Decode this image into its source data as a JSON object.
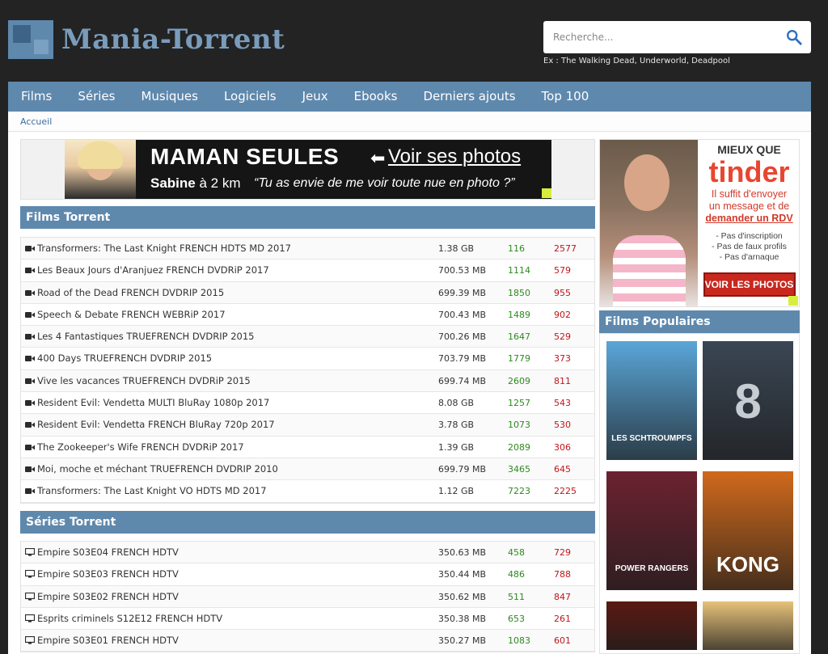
{
  "site": {
    "logo_text": "Mania-Torrent",
    "search_placeholder": "Recherche...",
    "search_hint": "Ex : The Walking Dead, Underworld, Deadpool"
  },
  "nav": {
    "items": [
      "Films",
      "Séries",
      "Musiques",
      "Logiciels",
      "Jeux",
      "Ebooks",
      "Derniers ajouts",
      "Top 100"
    ]
  },
  "breadcrumb": {
    "home": "Accueil"
  },
  "banner": {
    "title": "MAMAN SEULES",
    "cta": "Voir ses photos",
    "name": "Sabine",
    "distance": " à 2 km",
    "quote": "“Tu as envie de me voir toute  nue en photo ?”"
  },
  "films_section": {
    "title": "Films Torrent",
    "rows": [
      {
        "name": "Transformers: The Last Knight FRENCH HDTS MD 2017",
        "size": "1.38 GB",
        "seeds": "116",
        "leech": "2577"
      },
      {
        "name": "Les Beaux Jours d'Aranjuez FRENCH DVDRiP 2017",
        "size": "700.53 MB",
        "seeds": "1114",
        "leech": "579"
      },
      {
        "name": "Road of the Dead FRENCH DVDRIP 2015",
        "size": "699.39 MB",
        "seeds": "1850",
        "leech": "955"
      },
      {
        "name": "Speech & Debate FRENCH WEBRiP 2017",
        "size": "700.43 MB",
        "seeds": "1489",
        "leech": "902"
      },
      {
        "name": "Les 4 Fantastiques TRUEFRENCH DVDRIP 2015",
        "size": "700.26 MB",
        "seeds": "1647",
        "leech": "529"
      },
      {
        "name": "400 Days TRUEFRENCH DVDRIP 2015",
        "size": "703.79 MB",
        "seeds": "1779",
        "leech": "373"
      },
      {
        "name": "Vive les vacances TRUEFRENCH DVDRiP 2015",
        "size": "699.74 MB",
        "seeds": "2609",
        "leech": "811"
      },
      {
        "name": "Resident Evil: Vendetta MULTI BluRay 1080p 2017",
        "size": "8.08 GB",
        "seeds": "1257",
        "leech": "543"
      },
      {
        "name": "Resident Evil: Vendetta FRENCH BluRay 720p 2017",
        "size": "3.78 GB",
        "seeds": "1073",
        "leech": "530"
      },
      {
        "name": "The Zookeeper's Wife FRENCH DVDRiP 2017",
        "size": "1.39 GB",
        "seeds": "2089",
        "leech": "306"
      },
      {
        "name": "Moi, moche et méchant TRUEFRENCH DVDRIP 2010",
        "size": "699.79 MB",
        "seeds": "3465",
        "leech": "645"
      },
      {
        "name": "Transformers: The Last Knight VO HDTS MD 2017",
        "size": "1.12 GB",
        "seeds": "7223",
        "leech": "2225"
      }
    ]
  },
  "series_section": {
    "title": "Séries Torrent",
    "rows": [
      {
        "name": "Empire S03E04 FRENCH HDTV",
        "size": "350.63 MB",
        "seeds": "458",
        "leech": "729"
      },
      {
        "name": "Empire S03E03 FRENCH HDTV",
        "size": "350.44 MB",
        "seeds": "486",
        "leech": "788"
      },
      {
        "name": "Empire S03E02 FRENCH HDTV",
        "size": "350.62 MB",
        "seeds": "511",
        "leech": "847"
      },
      {
        "name": "Esprits criminels S12E12 FRENCH HDTV",
        "size": "350.38 MB",
        "seeds": "653",
        "leech": "261"
      },
      {
        "name": "Empire S03E01 FRENCH HDTV",
        "size": "350.27 MB",
        "seeds": "1083",
        "leech": "601"
      }
    ]
  },
  "side_ad": {
    "kicker": "MIEUX QUE",
    "brand": "tinder",
    "line1": "Il suffit d'envoyer",
    "line2": "un message et de",
    "line3": "demander un RDV",
    "bullet1": "- Pas d'inscription",
    "bullet2": "- Pas de faux profils",
    "bullet3": "- Pas d'arnaque",
    "button": "VOIR LES PHOTOS"
  },
  "popular": {
    "title": "Films Populaires",
    "posters": [
      {
        "title": "LES SCHTROUMPFS",
        "color": "#5aa6d8"
      },
      {
        "title": "8",
        "color": "#3a4654"
      },
      {
        "title": "POWER RANGERS",
        "color": "#6c2230"
      },
      {
        "title": "KONG",
        "color": "#d06a1c"
      },
      {
        "title": "",
        "color": "#5a1a12"
      },
      {
        "title": "",
        "color": "#e7c27a"
      }
    ]
  }
}
